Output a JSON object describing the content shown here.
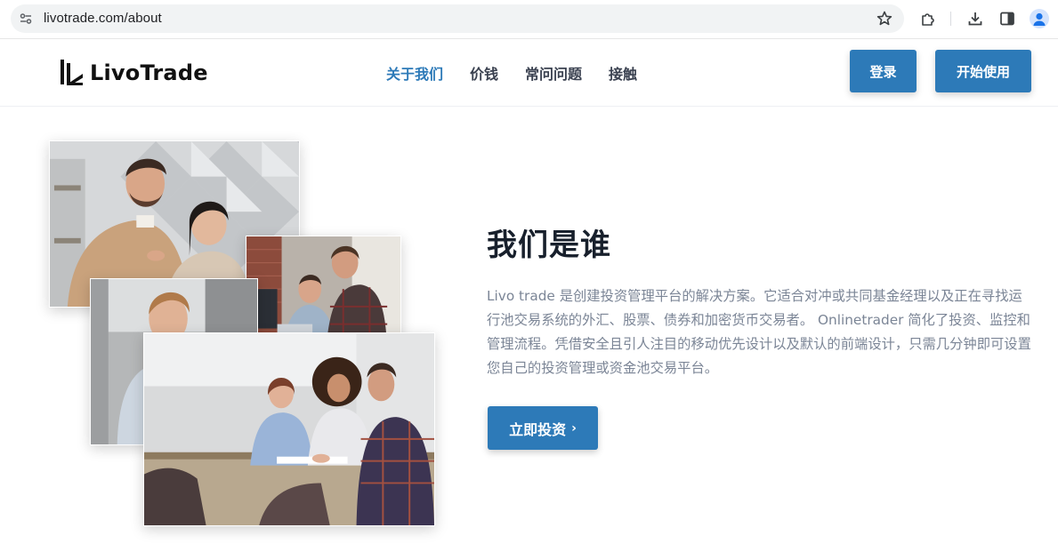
{
  "browser": {
    "url": "livotrade.com/about",
    "icons": [
      "site-info-icon",
      "star-icon",
      "extensions-icon",
      "download-icon",
      "side-panel-icon",
      "profile-icon"
    ]
  },
  "header": {
    "logo_text": "LivoTrade",
    "nav": [
      {
        "label": "关于我们",
        "active": true
      },
      {
        "label": "价钱",
        "active": false
      },
      {
        "label": "常问问题",
        "active": false
      },
      {
        "label": "接触",
        "active": false
      }
    ],
    "login_label": "登录",
    "start_label": "开始使用"
  },
  "about": {
    "title": "我们是谁",
    "body": "Livo trade 是创建投资管理平台的解决方案。它适合对冲或共同基金经理以及正在寻找运行池交易系统的外汇、股票、债券和加密货币交易者。 Onlinetrader 简化了投资、监控和管理流程。凭借安全且引人注目的移动优先设计以及默认的前端设计，只需几分钟即可设置您自己的投资管理或资金池交易平台。",
    "cta_label": "立即投资",
    "cta_icon": "chevron-right-icon"
  },
  "colors": {
    "brand": "#2d7ab8",
    "body_text": "#7b8596",
    "heading": "#18202c"
  }
}
